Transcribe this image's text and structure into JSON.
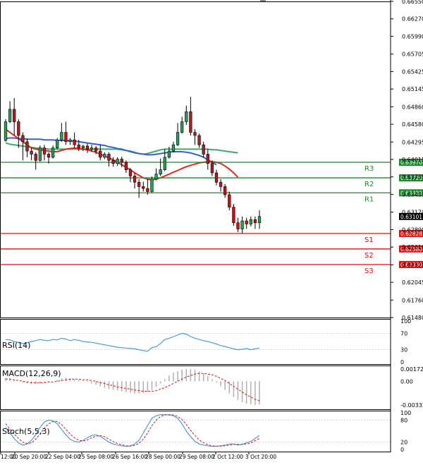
{
  "panels": {
    "rsi_label": "RSI(14)",
    "macd_label": "MACD(12,26,9)",
    "stoch_label": "Stoch(5,5,3)"
  },
  "colors": {
    "bull": "#2e9d57",
    "bear": "#c41414",
    "ma_fast": "#e8261d",
    "ma_mid": "#3b5fd0",
    "ma_slow": "#3aaa6e",
    "resistance": "#1a8a2a",
    "support": "#e01010",
    "indicator": "#4a9cd6",
    "macd_hist": "#b0b0b0",
    "stoch_signal": "#e01010",
    "price_tag": "#000000"
  },
  "chart_data": {
    "type": "candlestick",
    "price_axis": {
      "ylim": [
        0.6148,
        0.6655
      ],
      "ticks": [
        "0.66550",
        "0.66270",
        "0.65990",
        "0.65705",
        "0.65425",
        "0.65145",
        "0.64860",
        "0.64580",
        "0.64295",
        "0.64015",
        "0.63735",
        "0.63455",
        "0.63170",
        "0.62890",
        "0.62610",
        "0.62325",
        "0.62045",
        "0.61760",
        "0.61480"
      ]
    },
    "x_ticks": [
      "12:00",
      "20 Sep 20:00",
      "22 Sep 04:00",
      "25 Sep 08:00",
      "26 Sep 16:00",
      "28 Sep 00:00",
      "29 Sep 08:00",
      "2 Oct 12:00",
      "3 Oct 20:00"
    ],
    "candles": [
      [
        0.6432,
        0.6462,
        0.643,
        0.6466
      ],
      [
        0.6462,
        0.6482,
        0.646,
        0.6495
      ],
      [
        0.6482,
        0.6462,
        0.644,
        0.65
      ],
      [
        0.6462,
        0.644,
        0.642,
        0.6466
      ],
      [
        0.644,
        0.643,
        0.64,
        0.6445
      ],
      [
        0.643,
        0.6415,
        0.6405,
        0.6435
      ],
      [
        0.6415,
        0.641,
        0.64,
        0.642
      ],
      [
        0.641,
        0.64,
        0.6385,
        0.6413
      ],
      [
        0.64,
        0.642,
        0.6398,
        0.6424
      ],
      [
        0.642,
        0.641,
        0.64,
        0.6425
      ],
      [
        0.641,
        0.6405,
        0.6395,
        0.6413
      ],
      [
        0.6405,
        0.642,
        0.6403,
        0.6424
      ],
      [
        0.642,
        0.6433,
        0.6418,
        0.6436
      ],
      [
        0.6433,
        0.6445,
        0.643,
        0.646
      ],
      [
        0.6445,
        0.643,
        0.6425,
        0.6462
      ],
      [
        0.643,
        0.6433,
        0.6425,
        0.6436
      ],
      [
        0.6433,
        0.6425,
        0.642,
        0.6445
      ],
      [
        0.6425,
        0.642,
        0.6415,
        0.6433
      ],
      [
        0.642,
        0.6423,
        0.6415,
        0.6425
      ],
      [
        0.6423,
        0.6418,
        0.6412,
        0.6427
      ],
      [
        0.6418,
        0.642,
        0.6414,
        0.6425
      ],
      [
        0.642,
        0.6415,
        0.641,
        0.6423
      ],
      [
        0.6415,
        0.6405,
        0.64,
        0.6425
      ],
      [
        0.6405,
        0.641,
        0.6402,
        0.6413
      ],
      [
        0.641,
        0.64,
        0.639,
        0.6413
      ],
      [
        0.64,
        0.6395,
        0.639,
        0.6405
      ],
      [
        0.6395,
        0.6402,
        0.6391,
        0.6405
      ],
      [
        0.6402,
        0.6397,
        0.6389,
        0.6406
      ],
      [
        0.6397,
        0.6385,
        0.638,
        0.64
      ],
      [
        0.6385,
        0.6375,
        0.6365,
        0.6388
      ],
      [
        0.6375,
        0.6365,
        0.6355,
        0.638
      ],
      [
        0.6365,
        0.6358,
        0.634,
        0.637
      ],
      [
        0.6358,
        0.6355,
        0.635,
        0.6366
      ],
      [
        0.6355,
        0.635,
        0.6345,
        0.637
      ],
      [
        0.635,
        0.637,
        0.6348,
        0.6374
      ],
      [
        0.637,
        0.6378,
        0.6368,
        0.6387
      ],
      [
        0.6378,
        0.6385,
        0.6375,
        0.6403
      ],
      [
        0.6385,
        0.6405,
        0.6383,
        0.6418
      ],
      [
        0.6405,
        0.6415,
        0.6403,
        0.6422
      ],
      [
        0.6415,
        0.6425,
        0.6413,
        0.643
      ],
      [
        0.6425,
        0.6445,
        0.6423,
        0.646
      ],
      [
        0.6445,
        0.6462,
        0.6443,
        0.647
      ],
      [
        0.6462,
        0.6478,
        0.6457,
        0.6488
      ],
      [
        0.6478,
        0.6445,
        0.644,
        0.6502
      ],
      [
        0.6445,
        0.644,
        0.6425,
        0.645
      ],
      [
        0.644,
        0.6425,
        0.642,
        0.6443
      ],
      [
        0.6425,
        0.641,
        0.6405,
        0.643
      ],
      [
        0.641,
        0.6395,
        0.6385,
        0.6418
      ],
      [
        0.6395,
        0.638,
        0.6375,
        0.64
      ],
      [
        0.638,
        0.6365,
        0.636,
        0.6385
      ],
      [
        0.6365,
        0.6358,
        0.635,
        0.637
      ],
      [
        0.6358,
        0.6345,
        0.634,
        0.6362
      ],
      [
        0.6345,
        0.6325,
        0.632,
        0.635
      ],
      [
        0.6325,
        0.63,
        0.6295,
        0.633
      ],
      [
        0.63,
        0.629,
        0.6285,
        0.6308
      ],
      [
        0.629,
        0.6303,
        0.6283,
        0.631
      ],
      [
        0.6303,
        0.6298,
        0.629,
        0.6308
      ],
      [
        0.6298,
        0.6305,
        0.6294,
        0.631
      ],
      [
        0.6305,
        0.63,
        0.629,
        0.631
      ],
      [
        0.63,
        0.631,
        0.629,
        0.632
      ]
    ],
    "ma_fast": [
      0.645,
      0.6445,
      0.644,
      0.6435,
      0.643,
      0.6425,
      0.642,
      0.6418,
      0.6417,
      0.6416,
      0.6415,
      0.6414,
      0.6414,
      0.6416,
      0.6418,
      0.6419,
      0.642,
      0.6419,
      0.6418,
      0.6417,
      0.6415,
      0.6413,
      0.641,
      0.6407,
      0.6404,
      0.6401,
      0.6397,
      0.6393,
      0.6389,
      0.6385,
      0.638,
      0.6376,
      0.6372,
      0.637,
      0.6369,
      0.637,
      0.6372,
      0.6375,
      0.6378,
      0.6381,
      0.6384,
      0.6387,
      0.639,
      0.6392,
      0.6394,
      0.6396,
      0.6397,
      0.6398,
      0.6398,
      0.6397,
      0.6395,
      0.6391,
      0.6386,
      0.638,
      0.6373
    ],
    "ma_mid": [
      0.6435,
      0.6436,
      0.6436,
      0.6435,
      0.6435,
      0.6434,
      0.6434,
      0.6434,
      0.6434,
      0.6433,
      0.6433,
      0.6433,
      0.6432,
      0.6432,
      0.6432,
      0.6431,
      0.6431,
      0.643,
      0.6429,
      0.6428,
      0.6427,
      0.6426,
      0.6425,
      0.6424,
      0.6422,
      0.6421,
      0.6419,
      0.6418,
      0.6416,
      0.6414,
      0.6412,
      0.6411,
      0.641,
      0.6409,
      0.6409,
      0.641,
      0.6411,
      0.6412,
      0.6413,
      0.6414,
      0.6414,
      0.6414,
      0.6413,
      0.6412,
      0.641,
      0.6408,
      0.6405,
      0.6401,
      0.6397,
      0.6393
    ],
    "ma_slow": [
      0.6428,
      0.6426,
      0.6425,
      0.6424,
      0.6423,
      0.6422,
      0.6421,
      0.642,
      0.6419,
      0.6419,
      0.6418,
      0.6418,
      0.6418,
      0.6418,
      0.6418,
      0.6418,
      0.6418,
      0.6418,
      0.6418,
      0.6418,
      0.6418,
      0.6418,
      0.6418,
      0.6418,
      0.6418,
      0.6418,
      0.6418,
      0.6417,
      0.6416,
      0.6415,
      0.6413,
      0.6411,
      0.641,
      0.6411,
      0.6413,
      0.6415,
      0.6417,
      0.6418,
      0.6418,
      0.6418,
      0.6418,
      0.6418,
      0.6418,
      0.6418,
      0.6418,
      0.6418,
      0.6418,
      0.6418,
      0.6417,
      0.6417,
      0.6416,
      0.6415,
      0.6414,
      0.6413,
      0.6412
    ],
    "levels": [
      {
        "label": "R3",
        "value": 0.6397,
        "tag": "0.63970",
        "kind": "resistance"
      },
      {
        "label": "R2",
        "value": 0.6372,
        "tag": "0.63720",
        "kind": "resistance"
      },
      {
        "label": "R1",
        "value": 0.6348,
        "tag": "0.63480",
        "kind": "resistance"
      },
      {
        "label": "S1",
        "value": 0.62828,
        "tag": "0.62828",
        "kind": "support"
      },
      {
        "label": "S2",
        "value": 0.6258,
        "tag": "0.62580",
        "kind": "support"
      },
      {
        "label": "S3",
        "value": 0.6233,
        "tag": "0.62330",
        "kind": "support"
      }
    ],
    "current_price": {
      "value": 0.63101,
      "tag": "0.63101"
    },
    "rsi": {
      "ylim": [
        0,
        100
      ],
      "ticks": [
        "100",
        "70",
        "30",
        "0"
      ],
      "values": [
        55,
        54,
        50,
        48,
        45,
        47,
        50,
        52,
        55,
        53,
        52,
        55,
        54,
        58,
        56,
        52,
        55,
        53,
        50,
        49,
        48,
        46,
        44,
        42,
        40,
        38,
        36,
        35,
        34,
        33,
        32,
        30,
        28,
        26,
        35,
        37,
        45,
        55,
        58,
        62,
        66,
        70,
        68,
        62,
        58,
        55,
        52,
        50,
        47,
        44,
        40,
        38,
        35,
        32,
        30,
        31,
        33,
        30,
        32,
        34
      ]
    },
    "macd": {
      "ticks": [
        "0.00172",
        "0.00",
        "-0.003322"
      ],
      "ylim": [
        -0.0036,
        0.0019
      ],
      "histogram": [
        0.0005,
        0.0004,
        0.0002,
        0.0,
        -0.0002,
        -0.0003,
        -0.0004,
        -0.0004,
        -0.0003,
        -0.0002,
        -0.0001,
        0.0,
        0.0002,
        0.0004,
        0.0005,
        0.0004,
        0.0003,
        0.0002,
        0.0001,
        -0.0001,
        -0.0003,
        -0.0005,
        -0.0007,
        -0.0009,
        -0.0011,
        -0.0012,
        -0.0013,
        -0.0014,
        -0.0015,
        -0.0016,
        -0.0017,
        -0.0017,
        -0.0016,
        -0.0015,
        -0.0012,
        -0.0008,
        -0.0003,
        0.0003,
        0.0008,
        0.0012,
        0.0014,
        0.0016,
        0.0017,
        0.0017,
        0.0016,
        0.0014,
        0.0011,
        0.0007,
        0.0003,
        -0.0002,
        -0.0007,
        -0.0012,
        -0.0017,
        -0.0022,
        -0.0026,
        -0.0029,
        -0.0031,
        -0.0032,
        -0.0033,
        -0.0032
      ],
      "signal": [
        0.0003,
        0.0003,
        0.0002,
        0.0001,
        0.0,
        -0.0001,
        -0.0002,
        -0.0002,
        -0.0002,
        -0.0002,
        -0.0001,
        -0.0001,
        0.0,
        0.0001,
        0.0002,
        0.0003,
        0.0003,
        0.0003,
        0.0002,
        0.0002,
        0.0001,
        0.0,
        -0.0002,
        -0.0003,
        -0.0005,
        -0.0006,
        -0.0008,
        -0.0009,
        -0.001,
        -0.0011,
        -0.0012,
        -0.0013,
        -0.0014,
        -0.0014,
        -0.0014,
        -0.0013,
        -0.0011,
        -0.0009,
        -0.0006,
        -0.0003,
        0.0,
        0.0003,
        0.0006,
        0.0008,
        0.001,
        0.0011,
        0.0011,
        0.001,
        0.0009,
        0.0007,
        0.0004,
        0.0001,
        -0.0003,
        -0.0007,
        -0.0011,
        -0.0015,
        -0.0019,
        -0.0022,
        -0.0025,
        -0.0027
      ]
    },
    "stoch": {
      "ylim": [
        0,
        100
      ],
      "ticks": [
        "100",
        "80",
        "20",
        "0"
      ],
      "main": [
        60,
        45,
        30,
        18,
        12,
        15,
        25,
        40,
        60,
        75,
        80,
        78,
        70,
        55,
        40,
        28,
        22,
        20,
        25,
        32,
        38,
        40,
        36,
        28,
        20,
        15,
        12,
        10,
        8,
        10,
        15,
        25,
        45,
        65,
        85,
        92,
        95,
        95,
        94,
        92,
        85,
        70,
        50,
        35,
        22,
        15,
        12,
        10,
        8,
        9,
        10,
        12,
        15,
        15,
        12,
        14,
        18,
        22,
        30,
        38
      ],
      "signal": [
        70,
        55,
        42,
        30,
        20,
        16,
        18,
        28,
        42,
        58,
        70,
        76,
        76,
        68,
        55,
        42,
        32,
        25,
        23,
        26,
        32,
        36,
        38,
        35,
        28,
        22,
        16,
        13,
        10,
        9,
        11,
        17,
        28,
        45,
        65,
        80,
        90,
        94,
        95,
        94,
        90,
        82,
        68,
        52,
        38,
        26,
        18,
        13,
        10,
        9,
        9,
        10,
        12,
        14,
        14,
        14,
        15,
        18,
        24,
        30
      ]
    }
  }
}
